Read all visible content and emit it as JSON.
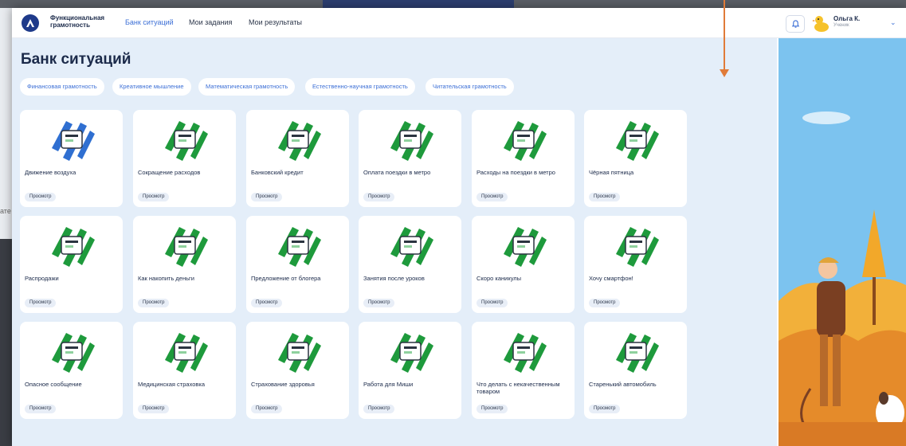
{
  "background": {
    "bleed_text": "ате"
  },
  "nav": {
    "brand_line1": "Функциональная",
    "brand_line2": "грамотность",
    "items": [
      {
        "label": "Банк ситуаций",
        "active": true
      },
      {
        "label": "Мои задания",
        "active": false
      },
      {
        "label": "Мои результаты",
        "active": false
      }
    ]
  },
  "user": {
    "name": "Ольга К.",
    "role": "Ученик",
    "menu_icon": "chevron-down-icon"
  },
  "page": {
    "title": "Банк ситуаций"
  },
  "filters": [
    "Финансовая грамотность",
    "Креативное мышление",
    "Математическая грамотность",
    "Естественно-научная грамотность",
    "Читательская грамотность"
  ],
  "view_label": "Просмотр",
  "cards": [
    {
      "title": "Движение воздуха",
      "theme": "blue"
    },
    {
      "title": "Сокращение расходов",
      "theme": "green"
    },
    {
      "title": "Банковский кредит",
      "theme": "green"
    },
    {
      "title": "Оплата поездки в метро",
      "theme": "green"
    },
    {
      "title": "Расходы на поездки в метро",
      "theme": "green"
    },
    {
      "title": "Чёрная пятница",
      "theme": "green"
    },
    {
      "title": "Распродажи",
      "theme": "green"
    },
    {
      "title": "Как накопить деньги",
      "theme": "green"
    },
    {
      "title": "Предложение от блогера",
      "theme": "green"
    },
    {
      "title": "Занятия после уроков",
      "theme": "green"
    },
    {
      "title": "Скоро каникулы",
      "theme": "green"
    },
    {
      "title": "Хочу смартфон!",
      "theme": "green"
    },
    {
      "title": "Опасное сообщение",
      "theme": "green"
    },
    {
      "title": "Медицинская страховка",
      "theme": "green"
    },
    {
      "title": "Страхование здоровья",
      "theme": "green"
    },
    {
      "title": "Работа для Миши",
      "theme": "green"
    },
    {
      "title": "Что делать с некачественным товаром",
      "theme": "green"
    },
    {
      "title": "Старенький автомобиль",
      "theme": "green"
    }
  ],
  "colors": {
    "accent": "#3c6fd6",
    "green": "#1e9a3c",
    "blue": "#2f6fd1",
    "annotation": "#e07b39"
  }
}
